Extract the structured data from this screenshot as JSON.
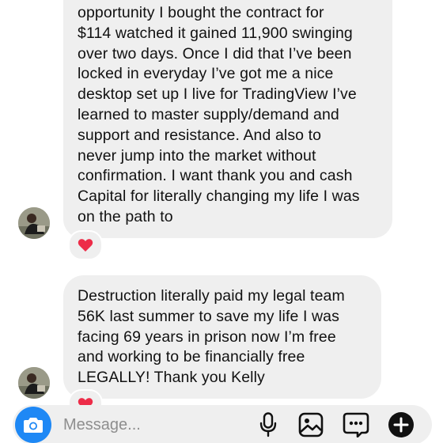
{
  "messages": [
    {
      "lines": [
        "opportunity I bought the contract for",
        "$114 watched it gained 11,900 swinging",
        "over two days. Once I did that I’ve been",
        "locked in everyday I’ve got me a nice",
        "desktop set up I live for TradingView I’ve",
        "learned to master supply/demand and",
        "support and resistance. And also to",
        "never jump into the market without",
        "confirmation. I want thank you and cash",
        "Capital for literally changing my life I was",
        "on the path to"
      ],
      "reaction": "❤️"
    },
    {
      "lines": [
        "Destruction literally paid my legal team",
        "56K last summer to save my life I was",
        "facing 69 years in prison now I’m free",
        "and working to be financially free",
        "LEGALLY! Thank you Kelly"
      ],
      "reaction": "❤️"
    }
  ],
  "composer": {
    "placeholder": "Message...",
    "value": ""
  },
  "icons": {
    "camera": "camera-icon",
    "mic": "microphone-icon",
    "gallery": "gallery-icon",
    "sticker": "sticker-chat-icon",
    "add": "plus-circle-icon"
  },
  "colors": {
    "bubble": "#efefef",
    "accent": "#1e88f5",
    "text": "#111111",
    "heart": "#ed2c48"
  }
}
